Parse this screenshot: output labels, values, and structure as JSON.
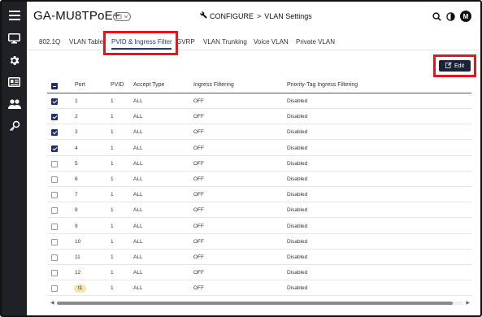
{
  "header": {
    "device_name": "GA-MU8TPoE+",
    "breadcrumb_section": "CONFIGURE",
    "breadcrumb_separator": ">",
    "breadcrumb_page": "VLAN Settings",
    "avatar_initial": "M"
  },
  "tabs": [
    {
      "label": "802.1Q"
    },
    {
      "label": "VLAN Table"
    },
    {
      "label": "PVID & Ingress Filter",
      "active": true
    },
    {
      "label": "GVRP"
    },
    {
      "label": "VLAN Trunking"
    },
    {
      "label": "Voice VLAN"
    },
    {
      "label": "Private VLAN"
    }
  ],
  "toolbar": {
    "edit_label": "Edit"
  },
  "table": {
    "columns": [
      "Port",
      "PVID",
      "Accept Type",
      "Ingress Filtering",
      "Priority-Tag Ingress Filtering"
    ],
    "rows": [
      {
        "port": "1",
        "pvid": "1",
        "accept_type": "ALL",
        "ingress": "OFF",
        "priority_tag": "Disabled",
        "checked": true
      },
      {
        "port": "2",
        "pvid": "1",
        "accept_type": "ALL",
        "ingress": "OFF",
        "priority_tag": "Disabled",
        "checked": true
      },
      {
        "port": "3",
        "pvid": "1",
        "accept_type": "ALL",
        "ingress": "OFF",
        "priority_tag": "Disabled",
        "checked": true
      },
      {
        "port": "4",
        "pvid": "1",
        "accept_type": "ALL",
        "ingress": "OFF",
        "priority_tag": "Disabled",
        "checked": true
      },
      {
        "port": "5",
        "pvid": "1",
        "accept_type": "ALL",
        "ingress": "OFF",
        "priority_tag": "Disabled",
        "checked": false
      },
      {
        "port": "6",
        "pvid": "1",
        "accept_type": "ALL",
        "ingress": "OFF",
        "priority_tag": "Disabled",
        "checked": false
      },
      {
        "port": "7",
        "pvid": "1",
        "accept_type": "ALL",
        "ingress": "OFF",
        "priority_tag": "Disabled",
        "checked": false
      },
      {
        "port": "8",
        "pvid": "1",
        "accept_type": "ALL",
        "ingress": "OFF",
        "priority_tag": "Disabled",
        "checked": false
      },
      {
        "port": "9",
        "pvid": "1",
        "accept_type": "ALL",
        "ingress": "OFF",
        "priority_tag": "Disabled",
        "checked": false
      },
      {
        "port": "10",
        "pvid": "1",
        "accept_type": "ALL",
        "ingress": "OFF",
        "priority_tag": "Disabled",
        "checked": false
      },
      {
        "port": "11",
        "pvid": "1",
        "accept_type": "ALL",
        "ingress": "OFF",
        "priority_tag": "Disabled",
        "checked": false
      },
      {
        "port": "12",
        "pvid": "1",
        "accept_type": "ALL",
        "ingress": "OFF",
        "priority_tag": "Disabled",
        "checked": false
      },
      {
        "port": "t1",
        "pvid": "1",
        "accept_type": "ALL",
        "ingress": "OFF",
        "priority_tag": "Disabled",
        "checked": false,
        "trunk": true
      }
    ]
  },
  "sidebar": {
    "icons": [
      "menu-icon",
      "monitor-icon",
      "gear-icon",
      "id-card-icon",
      "users-icon",
      "key-icon"
    ]
  },
  "header_icons": [
    "device-switch-icon",
    "wrench-icon",
    "search-icon",
    "contrast-icon"
  ],
  "colors": {
    "sidebar_bg": "#1f2126",
    "accent": "#1f3a8a",
    "checkbox_checked": "#1f2f6b",
    "edit_button_bg": "#1a2235",
    "highlight_red": "#e3161d",
    "trunk_badge": "#f5e4a6"
  }
}
